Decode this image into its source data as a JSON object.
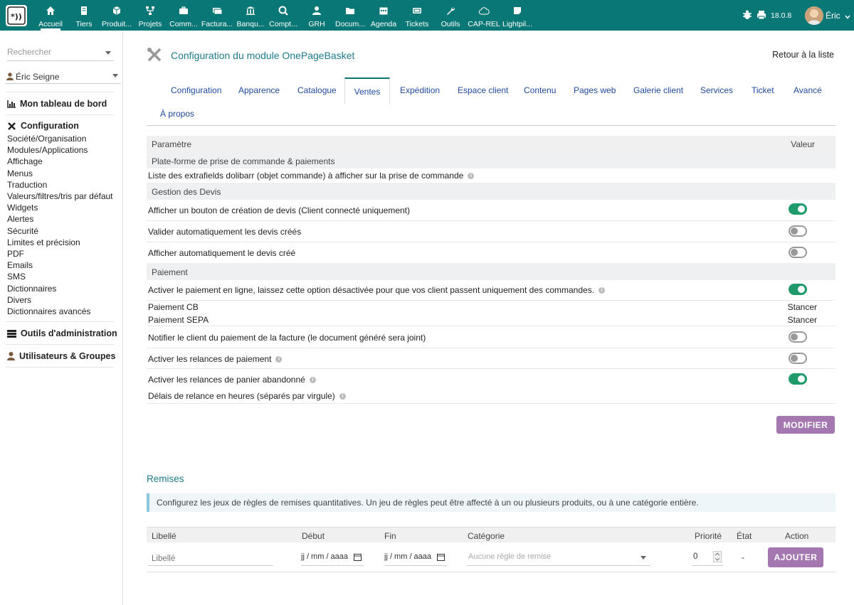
{
  "topbar": {
    "menu": [
      {
        "label": "Accueil",
        "icon": "home-icon"
      },
      {
        "label": "Tiers",
        "icon": "building-icon"
      },
      {
        "label": "Produit...",
        "icon": "cube-icon"
      },
      {
        "label": "Projets",
        "icon": "sitemap-icon"
      },
      {
        "label": "Comm...",
        "icon": "suitcase-icon"
      },
      {
        "label": "Factura...",
        "icon": "money-icon"
      },
      {
        "label": "Banqu...",
        "icon": "bank-icon"
      },
      {
        "label": "Compt...",
        "icon": "search-dollar-icon"
      },
      {
        "label": "GRH",
        "icon": "user-tie-icon"
      },
      {
        "label": "Docum...",
        "icon": "folder-icon"
      },
      {
        "label": "Agenda",
        "icon": "calendar-icon"
      },
      {
        "label": "Tickets",
        "icon": "ticket-icon"
      },
      {
        "label": "Outils",
        "icon": "wrench-icon"
      },
      {
        "label": "CAP-REL",
        "icon": "cloud-icon"
      },
      {
        "label": "Lightpil...",
        "icon": "sticky-note-icon"
      }
    ],
    "version": "18.0.8",
    "user": "Éric",
    "accent": "#0a7777"
  },
  "sidebar": {
    "search_placeholder": "Rechercher",
    "user_select": "Éric Seigne",
    "dashboard": "Mon tableau de bord",
    "config_title": "Configuration",
    "config_items": [
      "Société/Organisation",
      "Modules/Applications",
      "Affichage",
      "Menus",
      "Traduction",
      "Valeurs/filtres/tris par défaut",
      "Widgets",
      "Alertes",
      "Sécurité",
      "Limites et précision",
      "PDF",
      "Emails",
      "SMS",
      "Dictionnaires",
      "Divers",
      "Dictionnaires avancés"
    ],
    "admin_tools": "Outils d'administration",
    "users_groups": "Utilisateurs & Groupes"
  },
  "main": {
    "title": "Configuration du module OnePageBasket",
    "back_link": "Retour à la liste",
    "tabs": [
      "Configuration",
      "Apparence",
      "Catalogue",
      "Ventes",
      "Expédition",
      "Espace client",
      "Contenu",
      "Pages web",
      "Galerie client",
      "Services",
      "Ticket",
      "Avancé",
      "À propos"
    ],
    "active_tab": "Ventes",
    "table_head": {
      "param": "Paramètre",
      "value": "Valeur"
    },
    "groups": {
      "platform": "Plate-forme de prise de commande & paiements",
      "quotes": "Gestion des Devis",
      "payment": "Paiement"
    },
    "rows": {
      "extrafields": "Liste des extrafields dolibarr (objet commande) à afficher sur la prise de commande",
      "quote_button": "Afficher un bouton de création de devis (Client connecté uniquement)",
      "validate_quotes": "Valider automatiquement les devis créés",
      "show_quote": "Afficher automatiquement le devis créé",
      "online_payment": "Activer le paiement en ligne, laissez cette option désactivée pour que vos client passent uniquement des commandes.",
      "cb": "Paiement CB",
      "cb_value": "Stancer",
      "sepa": "Paiement SEPA",
      "sepa_value": "Stancer",
      "notify": "Notifier le client du paiement de la facture (le document généré sera joint)",
      "reminders": "Activer les relances de paiement",
      "abandoned": "Activer les relances de panier abandonné",
      "delay": "Délais de relance en heures (séparés par virgule)"
    },
    "toggles": {
      "quote_button": true,
      "validate_quotes": false,
      "show_quote": false,
      "online_payment": true,
      "notify": false,
      "reminders": false,
      "abandoned": true
    },
    "modify_button": "MODIFIER"
  },
  "remises": {
    "title": "Remises",
    "info": "Configurez les jeux de règles de remises quantitatives. Un jeu de règles peut être affecté à un ou plusieurs produits, ou à une catégorie entière.",
    "headers": {
      "libelle": "Libellé",
      "debut": "Début",
      "fin": "Fin",
      "categorie": "Catégorie",
      "priorite": "Priorité",
      "etat": "État",
      "action": "Action"
    },
    "libelle_placeholder": "Libellé",
    "date_placeholder": "jj / mm / aaaa",
    "category_placeholder": "Aucune règle de remise",
    "priority": "0",
    "state": "-",
    "add_button": "AJOUTER"
  }
}
